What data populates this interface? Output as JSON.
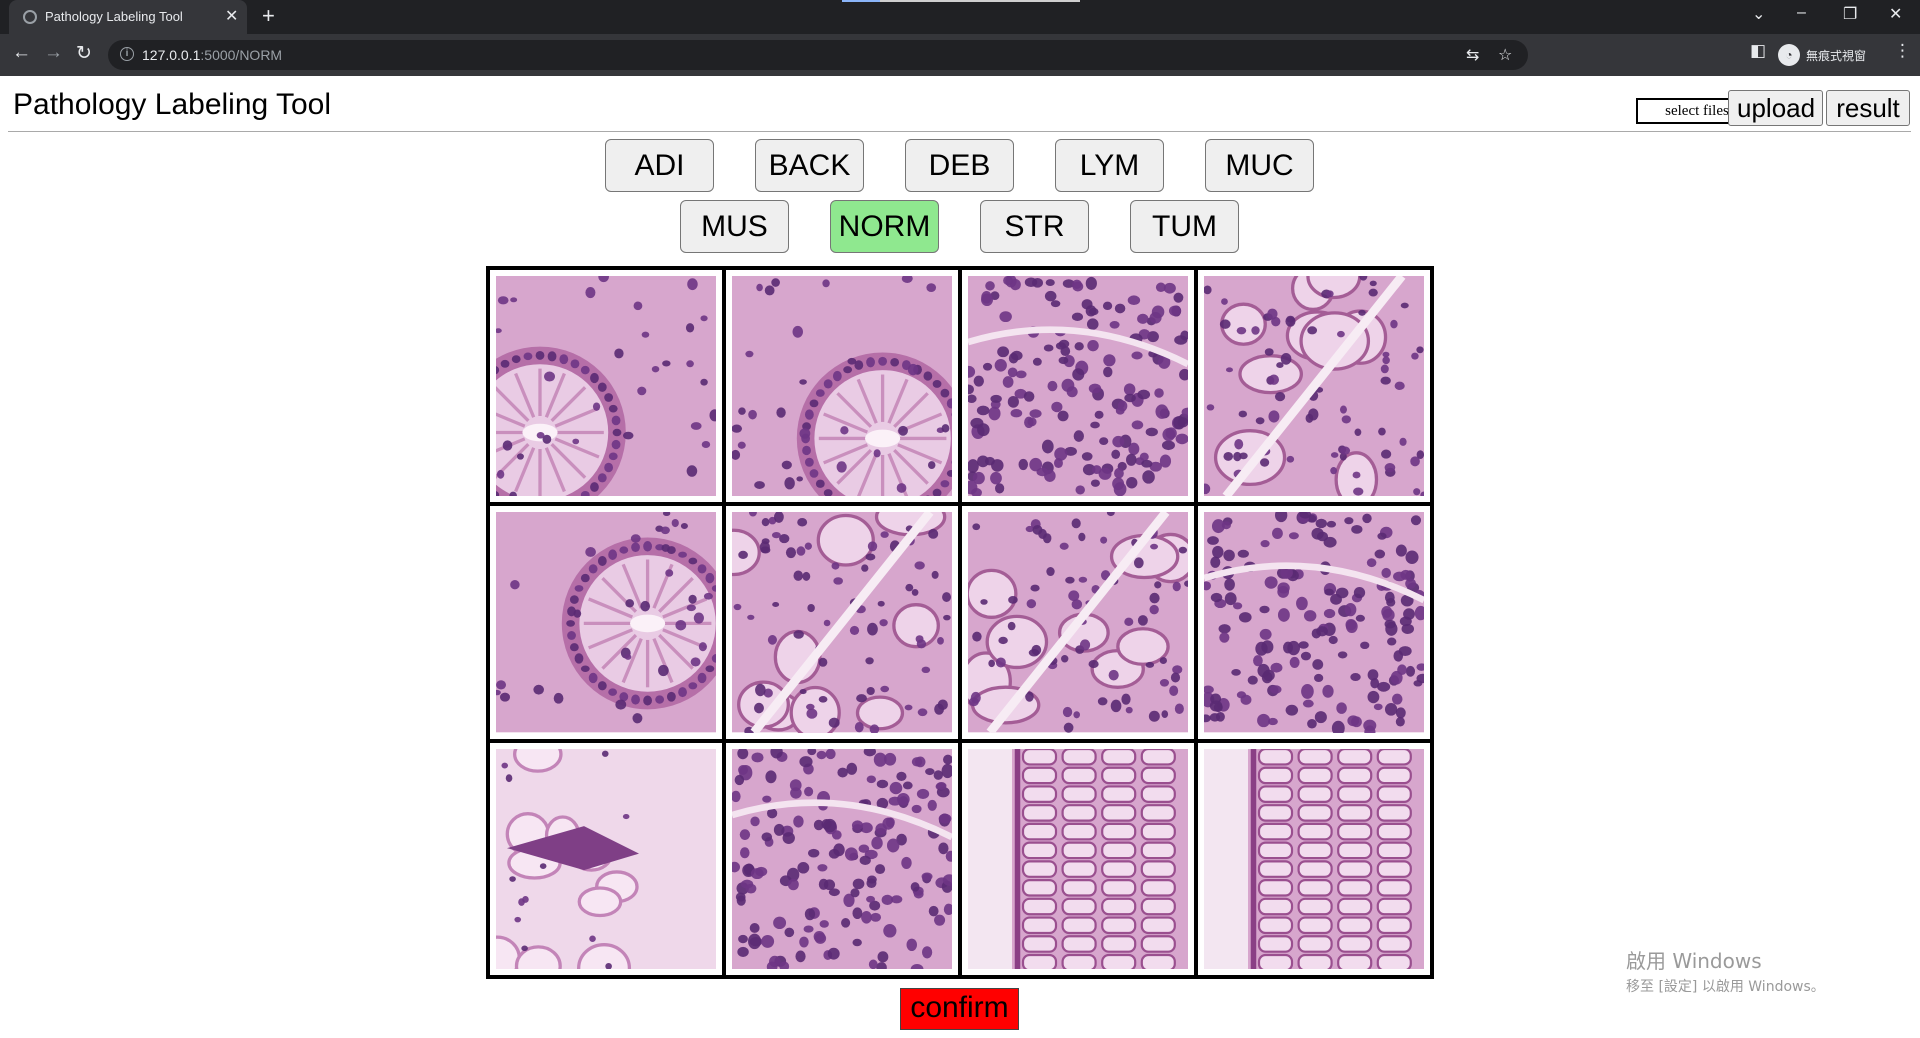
{
  "browser": {
    "tab_title": "Pathology Labeling Tool",
    "url_host": "127.0.0.1",
    "url_path": ":5000/NORM",
    "profile_label": "無痕式視窗"
  },
  "header": {
    "title": "Pathology Labeling Tool",
    "select_files_label": "select files",
    "upload_label": "upload",
    "result_label": "result"
  },
  "categories": {
    "row1": [
      "ADI",
      "BACK",
      "DEB",
      "LYM",
      "MUC"
    ],
    "row2": [
      "MUS",
      "NORM",
      "STR",
      "TUM"
    ],
    "selected": "NORM",
    "selected_color": "#8fe88f"
  },
  "grid": {
    "rows": 3,
    "columns": 4,
    "tiles": [
      {
        "variant": "crypt"
      },
      {
        "variant": "crypt"
      },
      {
        "variant": "lymph"
      },
      {
        "variant": "glandular"
      },
      {
        "variant": "crypt"
      },
      {
        "variant": "glandular"
      },
      {
        "variant": "glandular"
      },
      {
        "variant": "lymph"
      },
      {
        "variant": "mucus"
      },
      {
        "variant": "lymph"
      },
      {
        "variant": "columnar"
      },
      {
        "variant": "columnar"
      }
    ]
  },
  "confirm": {
    "label": "confirm",
    "color": "#ff0000"
  },
  "watermark": {
    "line1": "啟用 Windows",
    "line2": "移至 [設定] 以啟用 Windows。"
  }
}
